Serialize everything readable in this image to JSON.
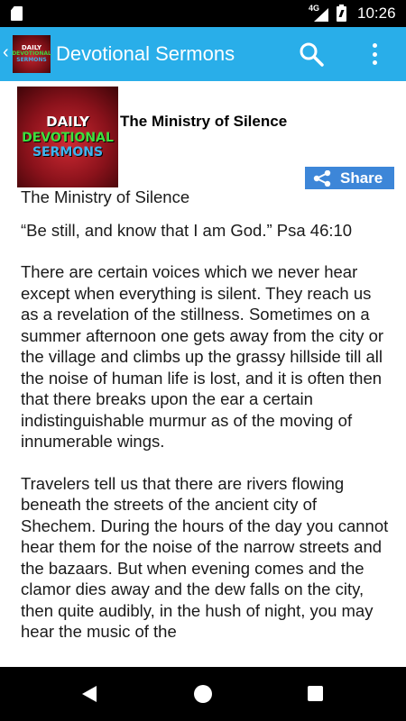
{
  "status_bar": {
    "network_type": "4G",
    "time": "10:26"
  },
  "app_bar": {
    "back_chevron": "‹",
    "logo": {
      "line1": "DAILY",
      "line2": "DEVOTIONAL",
      "line3": "SERMONS"
    },
    "title": "Devotional Sermons",
    "icons": [
      "search-icon",
      "overflow-menu-icon"
    ]
  },
  "post": {
    "image": {
      "line1": "DAILY",
      "line2": "DEVOTIONAL",
      "line3": "SERMONS"
    },
    "title": "The Ministry of Silence",
    "share_label": "Share",
    "paragraphs": [
      "The Ministry of Silence",
      "“Be still, and know that I am God.” Psa 46:10",
      "There are certain voices which we never hear except when everything is silent. They reach us as a revelation of the stillness. Sometimes on a summer afternoon one gets away from the city or the village and climbs up the grassy hillside till all the noise of human life is lost, and it is often then that there breaks upon the ear a certain indistinguishable murmur as of the moving of innumerable wings.",
      "Travelers tell us that there are rivers flowing beneath the streets of the ancient city of Shechem. During the hours of the day you cannot hear them for the noise of the narrow streets and the bazaars. But when evening comes and the clamor dies away and the dew falls on the city, then quite audibly, in the hush of night, you may hear the music of the"
    ]
  },
  "colors": {
    "app_bar": "#29aee9",
    "share_button": "#3d86d8",
    "status_bar": "#000000",
    "nav_bar": "#000000"
  },
  "nav_bar": {
    "icons": [
      "back-triangle-icon",
      "home-circle-icon",
      "recents-square-icon"
    ]
  }
}
